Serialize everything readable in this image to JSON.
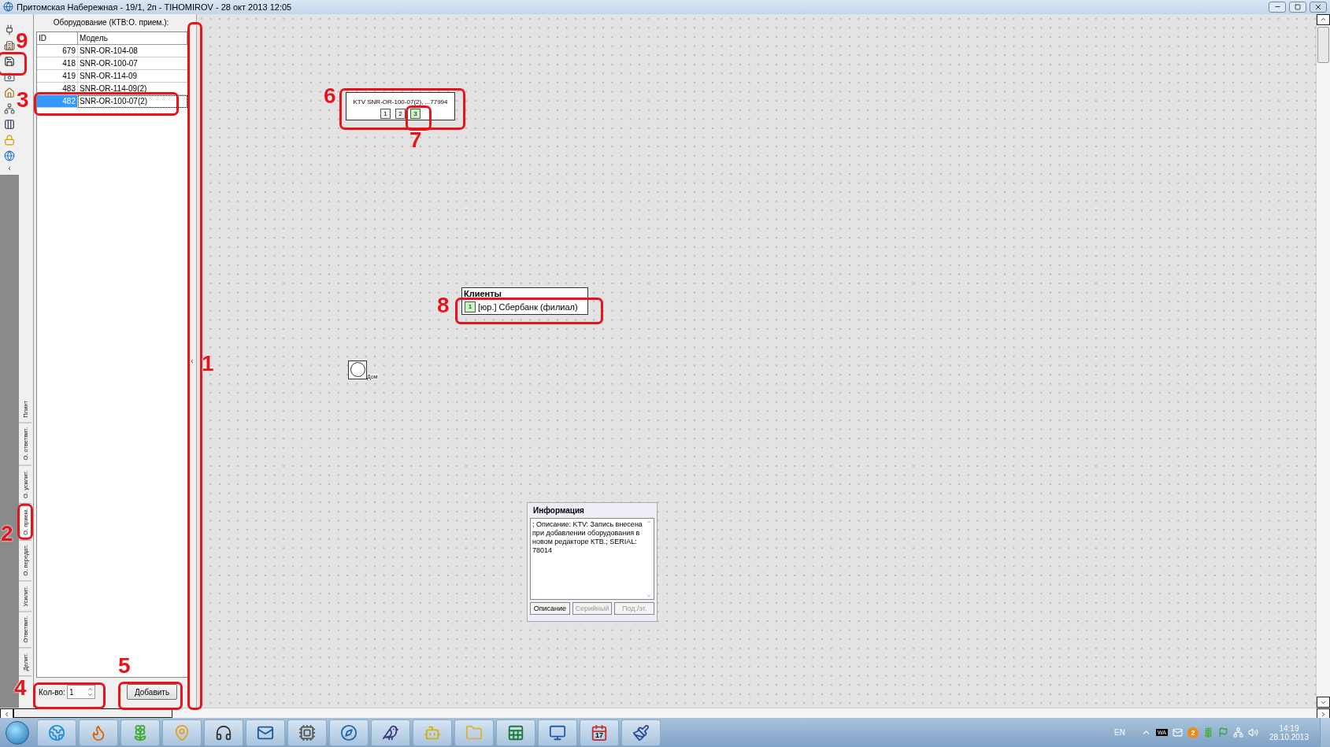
{
  "window": {
    "title": "Притомская Набережная - 19/1, 2п - TIHOMIROV - 28 окт 2013 12:05"
  },
  "toolbar": [
    {
      "kind": "plug"
    },
    {
      "kind": "building"
    },
    {
      "kind": "save"
    },
    {
      "kind": "camera"
    },
    {
      "kind": "home"
    },
    {
      "kind": "network"
    },
    {
      "kind": "columns"
    },
    {
      "kind": "lock"
    },
    {
      "kind": "globe"
    }
  ],
  "side_tabs": [
    {
      "label": "Плинт",
      "selected": false
    },
    {
      "label": "О. ответвит.",
      "selected": false
    },
    {
      "label": "О. усилит.",
      "selected": false
    },
    {
      "label": "О. прием.",
      "selected": true
    },
    {
      "label": "О. передат.",
      "selected": false
    },
    {
      "label": "Усилит.",
      "selected": false
    },
    {
      "label": "Ответвит.",
      "selected": false
    },
    {
      "label": "Делит.",
      "selected": false
    }
  ],
  "equipment": {
    "title": "Оборудование (КТВ:О. прием.):",
    "columns": [
      "ID",
      "Модель"
    ],
    "rows": [
      {
        "id": "679",
        "model": "SNR-OR-104-08",
        "selected": false
      },
      {
        "id": "418",
        "model": "SNR-OR-100-07",
        "selected": false
      },
      {
        "id": "419",
        "model": "SNR-OR-114-09",
        "selected": false
      },
      {
        "id": "483",
        "model": "SNR-OR-114-09(2)",
        "selected": false
      },
      {
        "id": "482",
        "model": "SNR-OR-100-07(2)",
        "selected": true
      }
    ],
    "quantity_label": "Кол-во:",
    "quantity": "1",
    "add_button": "Добавить"
  },
  "splitter": "‹",
  "canvas": {
    "device": {
      "label": "KTV SNR-OR-100-07(2), ...77994",
      "ports": [
        {
          "label": "1",
          "selected": false
        },
        {
          "label": "2",
          "selected": false
        },
        {
          "label": "3",
          "selected": true
        }
      ]
    },
    "clients": {
      "title": "Клиенты",
      "rows": [
        {
          "number": "1",
          "name": "[юр.] Сбербанк (филиал)"
        }
      ]
    },
    "house": {
      "label": "Дом"
    },
    "info": {
      "title": "Информация",
      "text": "; Описание: KTV: Запись внесена при добавлении оборудования в новом редакторе КТВ.; SERIAL: 78014",
      "tabs": [
        {
          "label": "Описание",
          "selected": true
        },
        {
          "label": "Серийный",
          "selected": false
        },
        {
          "label": "Под./эт.",
          "selected": false
        }
      ]
    }
  },
  "annotations": [
    "1",
    "2",
    "3",
    "4",
    "5",
    "6",
    "7",
    "8",
    "9"
  ],
  "taskbar": {
    "apps": [
      {
        "kind": "ie"
      },
      {
        "kind": "firefox"
      },
      {
        "kind": "flower"
      },
      {
        "kind": "map"
      },
      {
        "kind": "headset"
      },
      {
        "kind": "mail"
      },
      {
        "kind": "chip"
      },
      {
        "kind": "compass"
      },
      {
        "kind": "bird"
      },
      {
        "kind": "robot"
      },
      {
        "kind": "folder"
      },
      {
        "kind": "sheet"
      },
      {
        "kind": "remote"
      },
      {
        "kind": "calendar",
        "label": "17"
      },
      {
        "kind": "paint"
      }
    ],
    "language": "EN",
    "tray": [
      {
        "kind": "up"
      },
      {
        "kind": "wa",
        "label": "WA"
      },
      {
        "kind": "mail"
      },
      {
        "kind": "badge",
        "label": "2"
      },
      {
        "kind": "flower"
      },
      {
        "kind": "flag"
      },
      {
        "kind": "network"
      },
      {
        "kind": "volume"
      }
    ],
    "time": "14:19",
    "date": "28.10.2013"
  }
}
